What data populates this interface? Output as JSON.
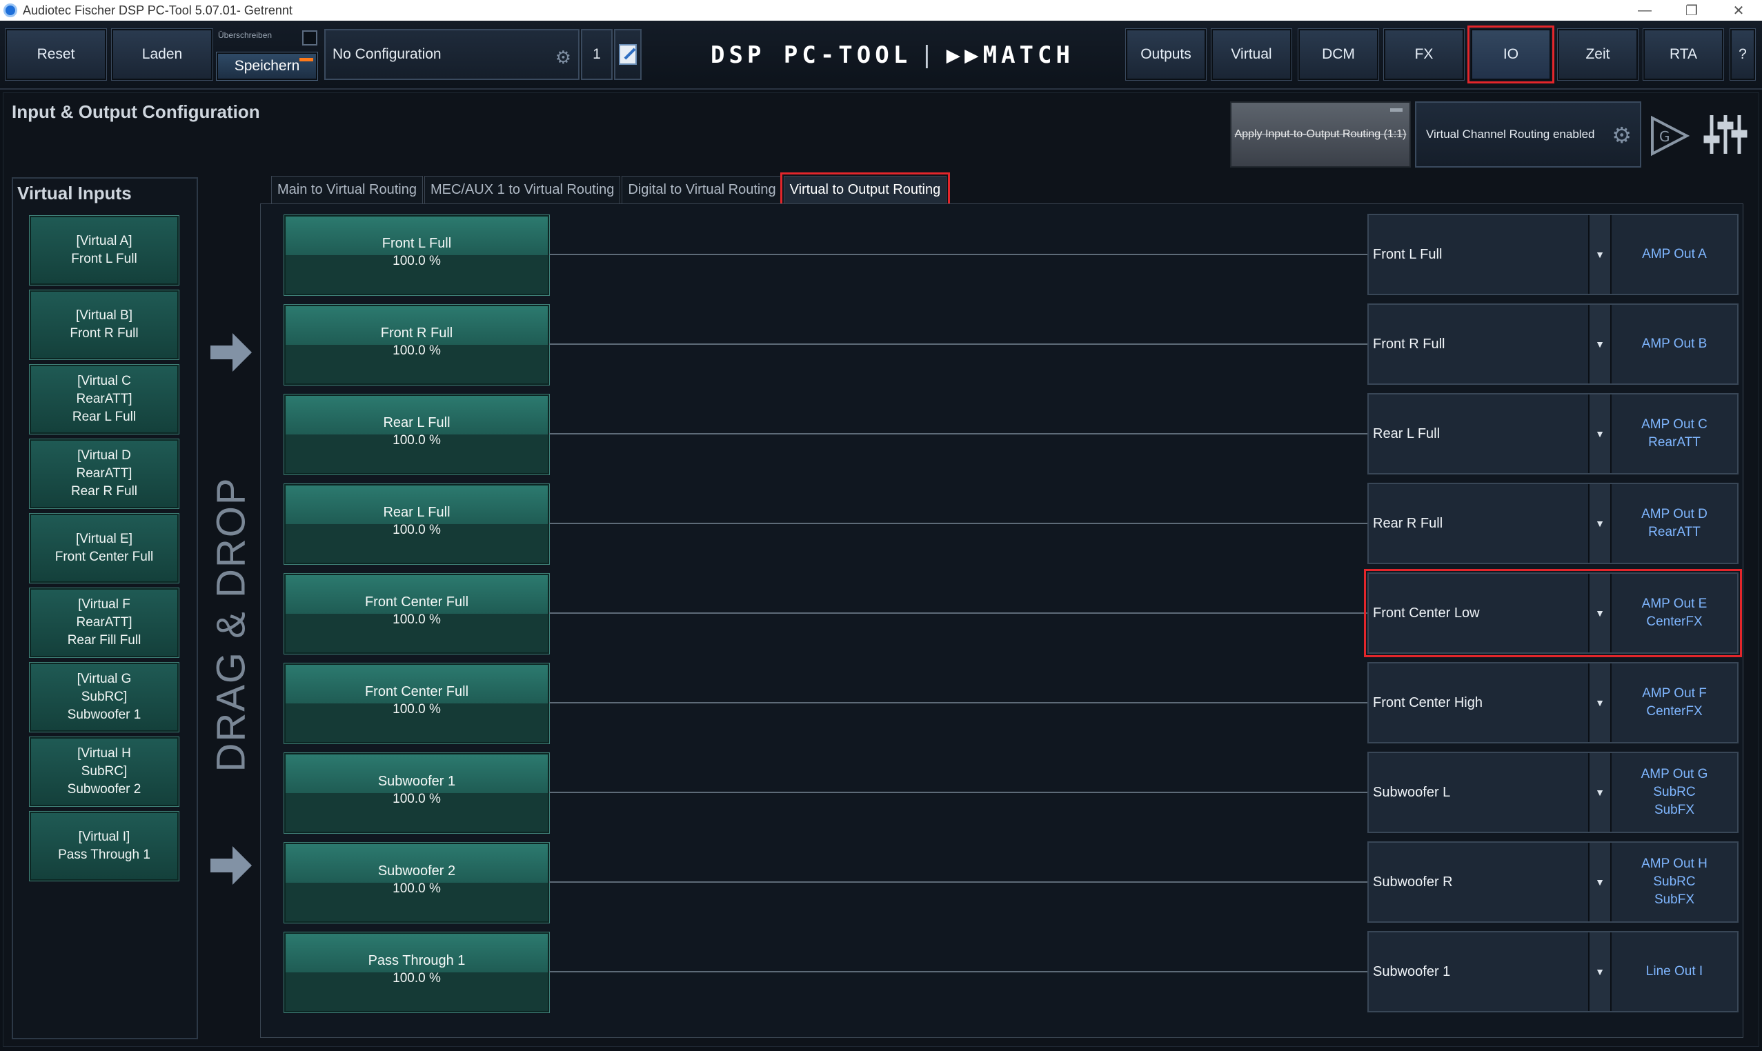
{
  "window": {
    "title": "Audiotec Fischer DSP PC-Tool 5.07.01- Getrennt",
    "controls": [
      "—",
      "❐",
      "✕"
    ]
  },
  "toolbar": {
    "reset_label": "Reset",
    "load_label": "Laden",
    "overwrite_label": "Überschreiben",
    "save_label": "Speichern",
    "config_name": "No Configuration",
    "config_number": "1",
    "logo_left": "DSP PC-TOOL",
    "logo_sep": "|",
    "logo_right": "▶▶MATCH",
    "nav": [
      {
        "label": "Outputs"
      },
      {
        "label": "Virtual"
      },
      {
        "label": "DCM"
      },
      {
        "label": "FX"
      },
      {
        "label": "IO"
      },
      {
        "label": "Zeit"
      },
      {
        "label": "RTA"
      },
      {
        "label": "?"
      }
    ]
  },
  "panel": {
    "title": "Input & Output Configuration",
    "apply_label": "Apply Input-to-Output Routing (1:1)",
    "virtual_routing_label": "Virtual Channel Routing enabled"
  },
  "virtual_inputs": {
    "title": "Virtual Inputs",
    "items": [
      {
        "label": "[Virtual A]\nFront L Full"
      },
      {
        "label": "[Virtual B]\nFront R Full"
      },
      {
        "label": "[Virtual C\nRearATT]\nRear L Full"
      },
      {
        "label": "[Virtual D\nRearATT]\nRear R Full"
      },
      {
        "label": "[Virtual E]\nFront Center Full"
      },
      {
        "label": "[Virtual F\nRearATT]\nRear Fill Full"
      },
      {
        "label": "[Virtual G\nSubRC]\nSubwoofer 1"
      },
      {
        "label": "[Virtual H\nSubRC]\nSubwoofer 2"
      },
      {
        "label": "[Virtual I]\nPass Through 1"
      }
    ]
  },
  "drag_drop_label": "DRAG & DROP",
  "tabs": [
    {
      "label": "Main to Virtual Routing"
    },
    {
      "label": "MEC/AUX 1 to Virtual Routing"
    },
    {
      "label": "Digital to Virtual Routing"
    },
    {
      "label": "Virtual to Output Routing"
    }
  ],
  "routing": [
    {
      "source": "Front L Full",
      "level": "100.0 %",
      "target": "Front L Full",
      "output": "AMP Out A"
    },
    {
      "source": "Front R Full",
      "level": "100.0 %",
      "target": "Front R Full",
      "output": "AMP Out B"
    },
    {
      "source": "Rear L Full",
      "level": "100.0 %",
      "target": "Rear L Full",
      "output": "AMP Out C\nRearATT"
    },
    {
      "source": "Rear L Full",
      "level": "100.0 %",
      "target": "Rear R Full",
      "output": "AMP Out D\nRearATT"
    },
    {
      "source": "Front Center Full",
      "level": "100.0 %",
      "target": "Front Center Low",
      "output": "AMP Out E\nCenterFX"
    },
    {
      "source": "Front Center Full",
      "level": "100.0 %",
      "target": "Front Center High",
      "output": "AMP Out F\nCenterFX"
    },
    {
      "source": "Subwoofer 1",
      "level": "100.0 %",
      "target": "Subwoofer L",
      "output": "AMP Out G\nSubRC\nSubFX"
    },
    {
      "source": "Subwoofer 2",
      "level": "100.0 %",
      "target": "Subwoofer R",
      "output": "AMP Out H\nSubRC\nSubFX"
    },
    {
      "source": "Pass Through 1",
      "level": "100.0 %",
      "target": "Subwoofer 1",
      "output": "Line Out I"
    }
  ],
  "colors": {
    "accent_teal": "#1f5c54",
    "output_text": "#7fb6ff",
    "highlight": "#e3262b",
    "save_indicator": "#ff7a1a"
  }
}
